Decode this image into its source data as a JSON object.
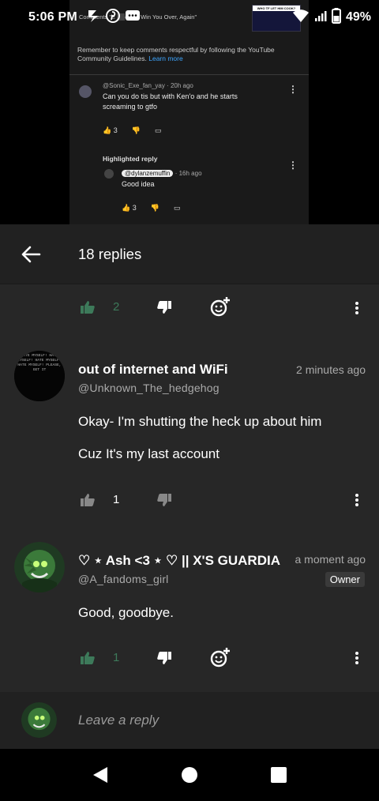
{
  "status_bar": {
    "time": "5:06 PM",
    "battery": "49%"
  },
  "embed": {
    "video_title_snippet": "Comments \"E",
    "video_title_rest": "es To Win You Over, Again\"",
    "thumb_caption": "WHO TF LET HIM COOK?",
    "guidelines": "Remember to keep comments respectful by following the YouTube Community Guidelines.",
    "learn_more": "Learn more",
    "comment_meta": "@Sonic_Exe_fan_yay · 20h ago",
    "comment_text": "Can you do tis but with Ken'o and he starts screaming to gtfo",
    "comment_likes": "3",
    "highlighted_label": "Highlighted reply",
    "reply_handle": "@dylanzemuffin",
    "reply_time": "· 16h ago",
    "reply_text": "Good idea",
    "reply_likes": "3"
  },
  "header": {
    "title": "18 replies"
  },
  "top_actions": {
    "likes": "2"
  },
  "comments": [
    {
      "author": "out of internet and WiFi",
      "handle": "@Unknown_The_hedgehog",
      "time": "2 minutes ago",
      "lines": [
        "Okay- I'm shutting the heck up about him",
        "Cuz It's my last account"
      ],
      "likes": "1",
      "avatar_text": "HATE MYSELF! HATE MYSELF! HATE MYSELF! HATE MYSELF! PLEASE, GET IT"
    },
    {
      "author": "♡ ⋆ Ash <3 ⋆ ♡ || X'S GUARDIAN",
      "handle": "@A_fandoms_girl",
      "time": "a moment ago",
      "badge": "Owner",
      "lines": [
        "Good, goodbye."
      ],
      "likes": "1"
    }
  ],
  "reply_bar": {
    "placeholder": "Leave a reply"
  },
  "colors": {
    "accent_like": "#3d7a5a",
    "bg": "#272727",
    "header_bg": "#212121"
  }
}
